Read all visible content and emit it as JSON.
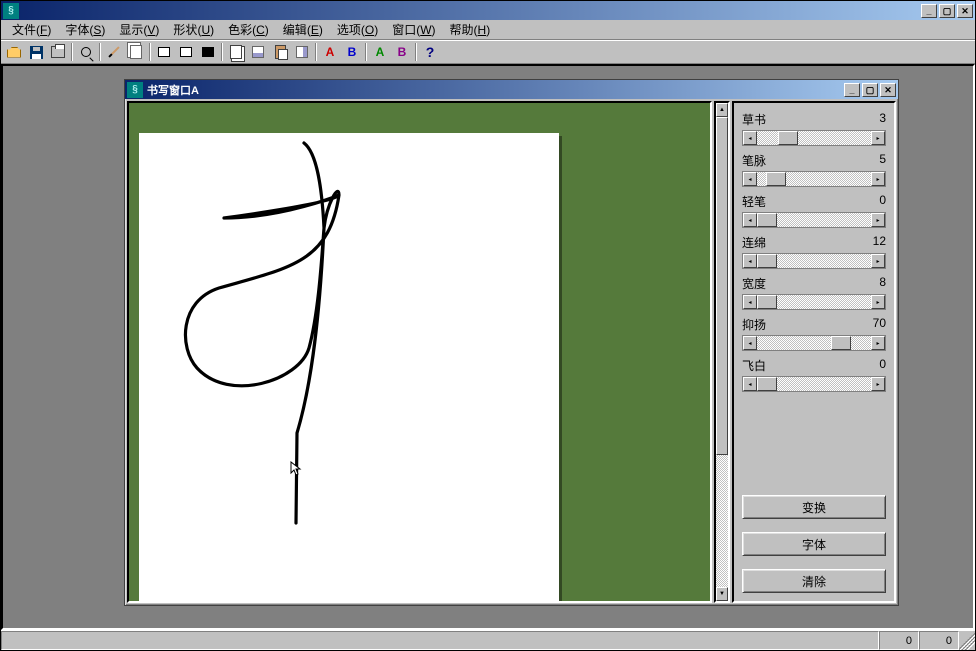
{
  "main_title": "",
  "menus": [
    {
      "label": "文件",
      "hk": "F"
    },
    {
      "label": "字体",
      "hk": "S"
    },
    {
      "label": "显示",
      "hk": "V"
    },
    {
      "label": "形状",
      "hk": "U"
    },
    {
      "label": "色彩",
      "hk": "C"
    },
    {
      "label": "编辑",
      "hk": "E"
    },
    {
      "label": "选项",
      "hk": "O"
    },
    {
      "label": "窗口",
      "hk": "W"
    },
    {
      "label": "帮助",
      "hk": "H"
    }
  ],
  "toolbar": {
    "open": "",
    "save": "",
    "print": "",
    "preview": "",
    "pencil": "",
    "pages": "",
    "r1": "",
    "r2": "",
    "r3": "",
    "copy": "",
    "stack": "",
    "paste": "",
    "hstack": "",
    "A1": "A",
    "B1": "B",
    "A2": "A",
    "B2": "B",
    "Q": "?"
  },
  "child_title": "书写窗口A",
  "sliders": [
    {
      "label": "草书",
      "value": 3,
      "pos": 18
    },
    {
      "label": "笔脉",
      "value": 5,
      "pos": 8
    },
    {
      "label": "轻笔",
      "value": 0,
      "pos": 0
    },
    {
      "label": "连绵",
      "value": 12,
      "pos": 0
    },
    {
      "label": "宽度",
      "value": 8,
      "pos": 0
    },
    {
      "label": "抑扬",
      "value": 70,
      "pos": 65
    },
    {
      "label": "飞白",
      "value": 0,
      "pos": 0
    }
  ],
  "buttons": {
    "transform": "变换",
    "font": "字体",
    "clear": "清除"
  },
  "status": {
    "main": "",
    "n1": "0",
    "n2": "0"
  }
}
